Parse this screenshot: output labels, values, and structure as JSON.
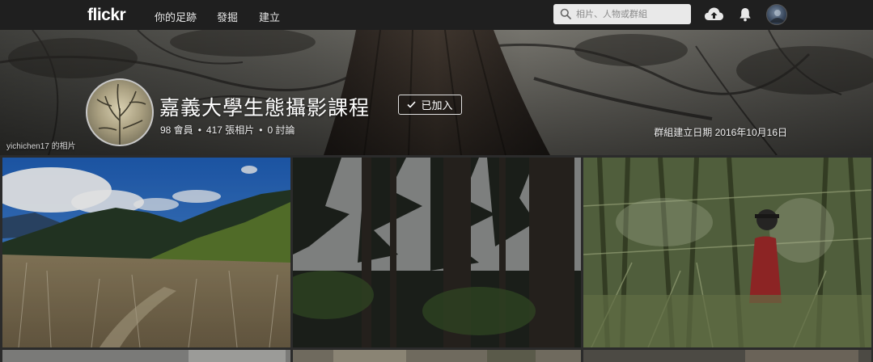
{
  "nav": {
    "logo": "flickr",
    "items": [
      {
        "label": "你的足跡"
      },
      {
        "label": "發掘"
      },
      {
        "label": "建立"
      }
    ],
    "search_placeholder": "相片、人物或群組"
  },
  "group": {
    "title": "嘉義大學生態攝影課程",
    "join_label": "已加入",
    "members": "98 會員",
    "photos": "417 張相片",
    "discussions": "0 討論",
    "created": "群組建立日期 2016年10月16日",
    "banner_credit": "yichichen17 的相片"
  },
  "icons": {
    "search": "search-icon",
    "upload": "cloud-upload-icon",
    "notifications": "bell-icon",
    "check": "check-icon"
  },
  "colors": {
    "topbar": "#1f1f1f",
    "background": "#2b2b2b",
    "search_bg": "#e9e9e9"
  }
}
